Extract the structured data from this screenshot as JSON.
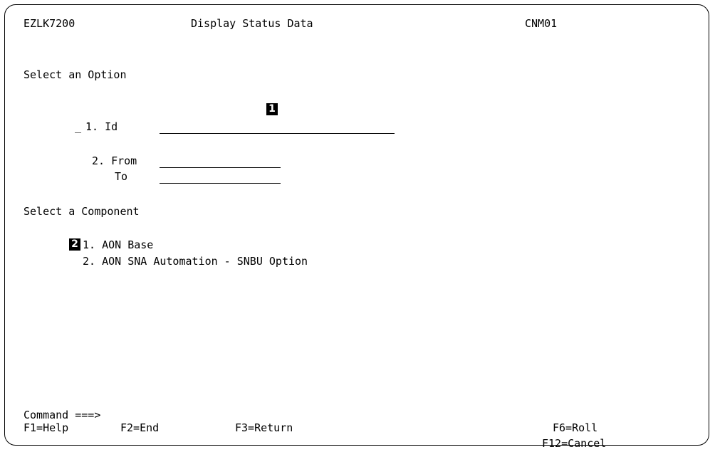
{
  "header": {
    "panel_id": "EZLK7200",
    "title": "Display Status Data",
    "domain": "CNM01"
  },
  "options": {
    "heading": "Select an Option",
    "selection_field_value": "_",
    "callout": "1",
    "id_label": "1. Id",
    "from_label": "2. From",
    "to_label": "To"
  },
  "components": {
    "heading": "Select a Component",
    "callout": "2",
    "items": [
      {
        "label": "1. AON Base"
      },
      {
        "label": "2. AON SNA Automation - SNBU Option"
      }
    ]
  },
  "command": {
    "prompt": "Command ===>"
  },
  "function_keys": {
    "f1": "F1=Help",
    "f2": "F2=End",
    "f3": "F3=Return",
    "f6": "F6=Roll",
    "f12": "F12=Cancel"
  }
}
